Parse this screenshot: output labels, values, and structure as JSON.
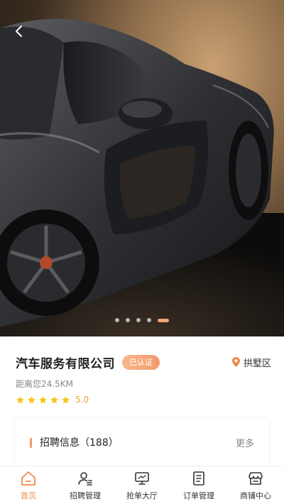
{
  "carousel": {
    "dot_count": 5,
    "active_index": 4
  },
  "shop": {
    "name": "汽车服务有限公司",
    "badge": "已认证",
    "location": "拱墅区",
    "distance": "距离您24.5KM",
    "rating": 5.0,
    "rating_label": "5.0",
    "stars": 5
  },
  "recruit": {
    "title": "招聘信息（188）",
    "more": "更多"
  },
  "tabbar": {
    "items": [
      {
        "label": "首页",
        "icon": "home-icon",
        "active": true
      },
      {
        "label": "招聘管理",
        "icon": "recruit-icon",
        "active": false
      },
      {
        "label": "抢单大厅",
        "icon": "monitor-icon",
        "active": false
      },
      {
        "label": "订单管理",
        "icon": "order-icon",
        "active": false
      },
      {
        "label": "商铺中心",
        "icon": "shop-icon",
        "active": false
      }
    ]
  },
  "colors": {
    "accent": "#f08a4b",
    "badge": "#f49a6b",
    "star": "#f5c518"
  }
}
